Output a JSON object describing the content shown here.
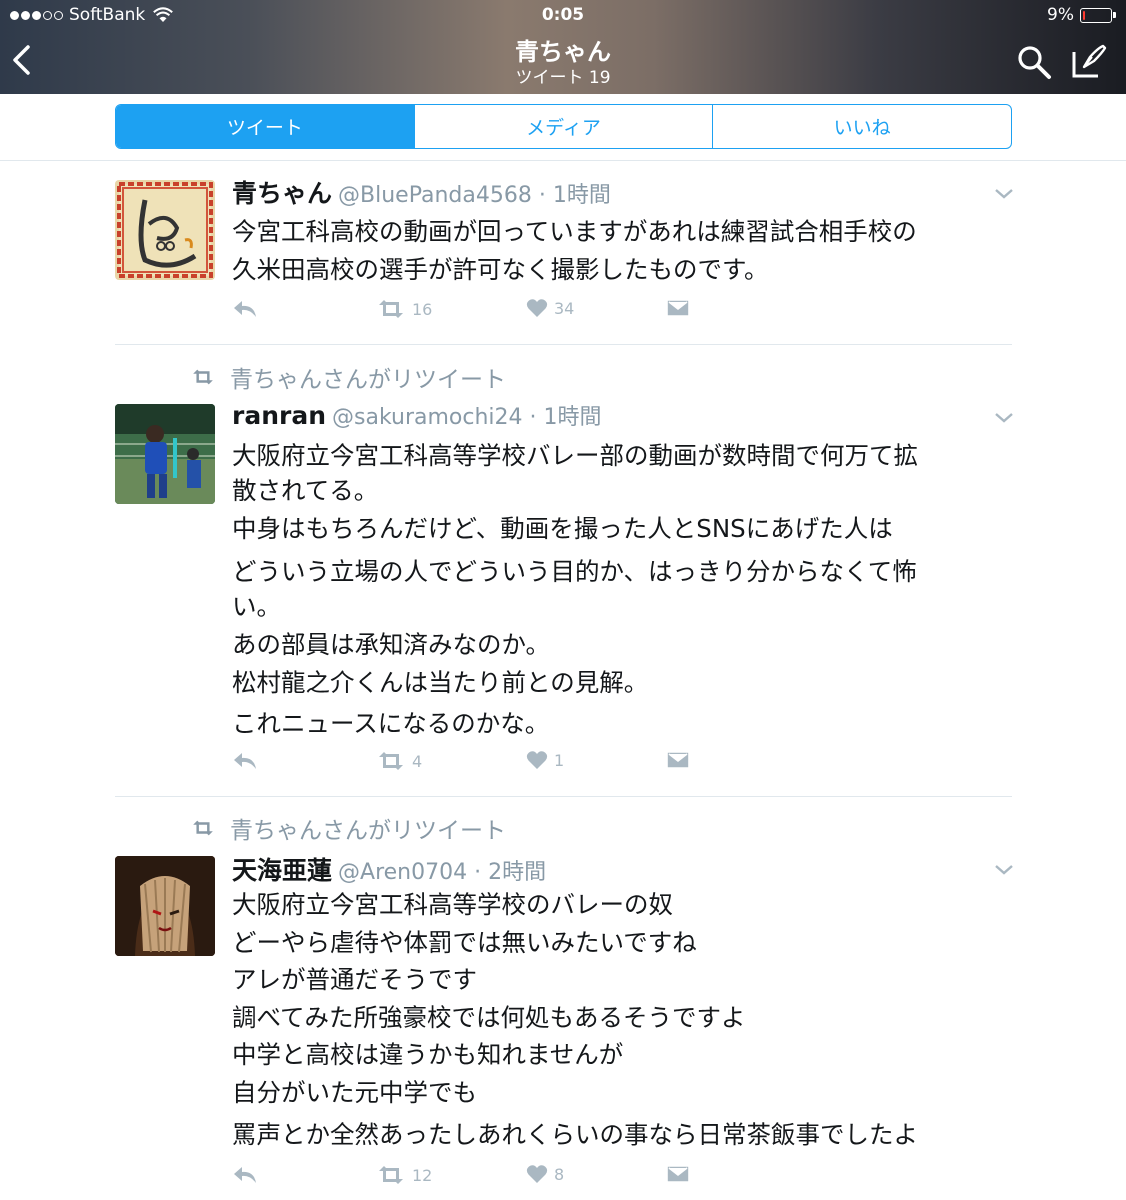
{
  "status_bar": {
    "carrier": "SoftBank",
    "time": "0:05",
    "battery": "9%",
    "battery_level": 0.09,
    "signal_bars": 3,
    "signal_total": 5
  },
  "nav": {
    "title": "青ちゃん",
    "subtitle": "ツイート 19"
  },
  "tabs": [
    {
      "label": "ツイート",
      "active": true
    },
    {
      "label": "メディア",
      "active": false
    },
    {
      "label": "いいね",
      "active": false
    }
  ],
  "tweets": [
    {
      "retweeted_by": "",
      "name": "青ちゃん",
      "handle_time": "@BluePanda4568 · 1時間",
      "lines": [
        "今宮工科高校の動画が回っていますがあれは練習試合相手校の",
        "久米田高校の選手が許可なく撮影したものです。"
      ],
      "retweets": "16",
      "likes": "34"
    },
    {
      "retweeted_by": "青ちゃんさんがリツイート",
      "name": "ranran",
      "handle_time": "@sakuramochi24 · 1時間",
      "lines": [
        "大阪府立今宮工科高等学校バレー部の動画が数時間で何万て拡",
        "散されてる。",
        "中身はもちろんだけど、動画を撮った人とSNSにあげた人は",
        "どういう立場の人でどういう目的か、はっきり分からなくて怖",
        "い。",
        "あの部員は承知済みなのか。",
        "松村龍之介くんは当たり前との見解。",
        "これニュースになるのかな。"
      ],
      "retweets": "4",
      "likes": "1"
    },
    {
      "retweeted_by": "青ちゃんさんがリツイート",
      "name": "天海亜蓮",
      "handle_time": "@Aren0704 · 2時間",
      "lines": [
        "大阪府立今宮工科高等学校のバレーの奴",
        "どーやら虐待や体罰では無いみたいですね",
        "アレが普通だそうです",
        "調べてみた所強豪校では何処もあるそうですよ",
        "中学と高校は違うかも知れませんが",
        "自分がいた元中学でも",
        "罵声とか全然あったしあれくらいの事なら日常茶飯事でしたよ"
      ],
      "retweets": "12",
      "likes": "8"
    }
  ],
  "icons": {
    "reply": "reply-icon",
    "retweet": "retweet-icon",
    "like": "heart-icon",
    "dm": "envelope-icon",
    "more": "chevron-down-icon"
  },
  "colors": {
    "accent": "#1da1f2",
    "muted": "#8899a6",
    "action": "#aab8c2",
    "battery_low": "#ff3b30"
  }
}
